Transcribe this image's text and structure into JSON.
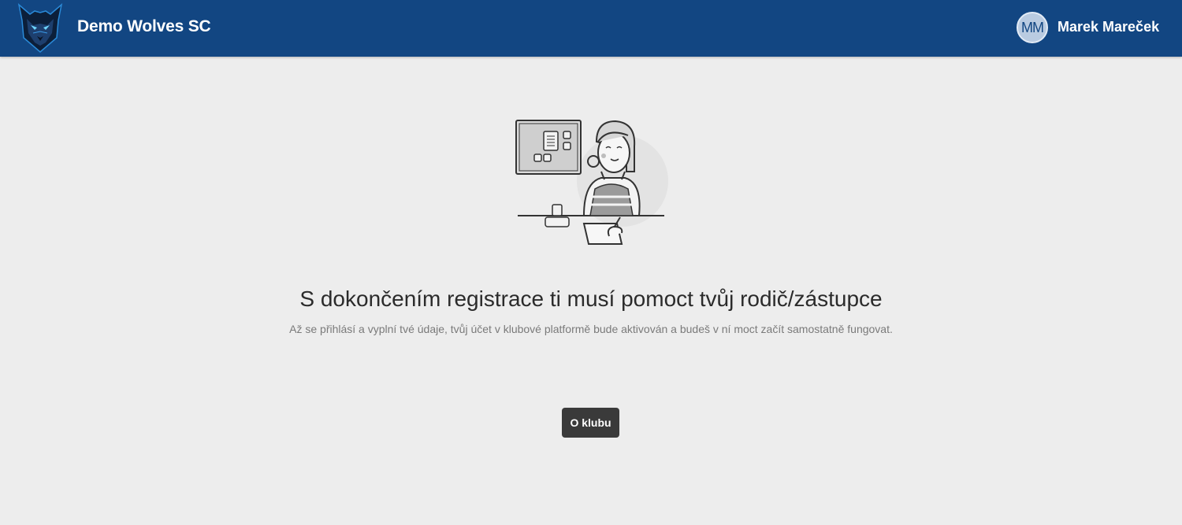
{
  "header": {
    "club_name": "Demo Wolves SC",
    "logo_icon": "wolf-logo-icon",
    "user": {
      "initials": "MM",
      "name": "Marek Mareček"
    },
    "background_color": "#124682"
  },
  "main": {
    "illustration_icon": "registration-assistant-illustration",
    "headline": "S dokončením registrace ti musí pomoct tvůj rodič/zástupce",
    "subline": "Až se přihlásí a vyplní tvé údaje, tvůj účet v klubové platformě bude aktivován a budeš v ní moct začít samostatně fungovat.",
    "about_button": "O klubu"
  }
}
